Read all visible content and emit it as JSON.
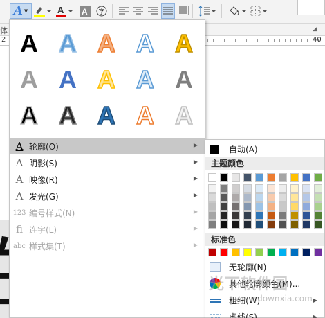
{
  "ribbon": {
    "text_effects_glyph": "A",
    "group_label": "体",
    "ruler_num_left": "2",
    "ruler_num_right": "40"
  },
  "document": {
    "chars": [
      "的",
      "卜",
      "轮"
    ]
  },
  "gallery": {
    "letter": "A",
    "items": [
      {
        "name": "solid-black",
        "fill": "#000000",
        "stroke": "none"
      },
      {
        "name": "blue-gradient",
        "fill": "#5b9bd5",
        "stroke": "#9cc3e6"
      },
      {
        "name": "orange-light",
        "fill": "#f4b183",
        "stroke": "#ed7d31"
      },
      {
        "name": "blue-outline",
        "fill": "#ffffff",
        "stroke": "#5b9bd5"
      },
      {
        "name": "gold",
        "fill": "#ffc000",
        "stroke": "#bf9000"
      },
      {
        "name": "grey",
        "fill": "#9e9e9e",
        "stroke": "none"
      },
      {
        "name": "blue-reflection",
        "fill": "#4472c4",
        "stroke": "none"
      },
      {
        "name": "yellow-outline",
        "fill": "#ffe699",
        "stroke": "#ffc000"
      },
      {
        "name": "blue-pale",
        "fill": "#ddebf7",
        "stroke": "#5b9bd5"
      },
      {
        "name": "grey-dark",
        "fill": "#7f7f7f",
        "stroke": "none"
      },
      {
        "name": "black-glow",
        "fill": "#000000",
        "stroke": "#bbbbbb"
      },
      {
        "name": "black-dark",
        "fill": "#262626",
        "stroke": "#7f7f7f"
      },
      {
        "name": "blue-bevel",
        "fill": "#2e75b6",
        "stroke": "#1f4e79"
      },
      {
        "name": "orange-outline",
        "fill": "#ffffff",
        "stroke": "#ed7d31"
      },
      {
        "name": "white-shadow",
        "fill": "#f2f2f2",
        "stroke": "#bfbfbf"
      }
    ]
  },
  "menu": {
    "items": [
      {
        "label": "轮廓(O)",
        "icon": "A",
        "highlighted": true,
        "disabled": false
      },
      {
        "label": "阴影(S)",
        "icon": "A",
        "highlighted": false,
        "disabled": false
      },
      {
        "label": "映像(R)",
        "icon": "A",
        "highlighted": false,
        "disabled": false
      },
      {
        "label": "发光(G)",
        "icon": "A",
        "highlighted": false,
        "disabled": false
      },
      {
        "label": "编号样式(N)",
        "icon": "123",
        "highlighted": false,
        "disabled": true
      },
      {
        "label": "连字(L)",
        "icon": "fi",
        "highlighted": false,
        "disabled": true
      },
      {
        "label": "样式集(T)",
        "icon": "abc",
        "highlighted": false,
        "disabled": true
      }
    ]
  },
  "outline_submenu": {
    "auto_label": "自动(A)",
    "theme_colors_title": "主题颜色",
    "theme_top_row": [
      "#ffffff",
      "#000000",
      "#e7e6e6",
      "#44546a",
      "#5b9bd5",
      "#ed7d31",
      "#a5a5a5",
      "#ffc000",
      "#4472c4",
      "#70ad47"
    ],
    "theme_shades": [
      [
        "#f2f2f2",
        "#7f7f7f",
        "#d0cece",
        "#d6dce4",
        "#ddebf7",
        "#fbe5d6",
        "#ededed",
        "#fff2cc",
        "#dae3f3",
        "#e2efda"
      ],
      [
        "#d9d9d9",
        "#595959",
        "#aeaaaa",
        "#adb9ca",
        "#bdd7ee",
        "#f8cbad",
        "#dbdbdb",
        "#ffe699",
        "#b4c7e7",
        "#c5e0b4"
      ],
      [
        "#bfbfbf",
        "#404040",
        "#757171",
        "#8497b0",
        "#9dc3e6",
        "#f4b183",
        "#c9c9c9",
        "#ffd966",
        "#8faadc",
        "#a9d18e"
      ],
      [
        "#a6a6a6",
        "#262626",
        "#3a3838",
        "#333f4f",
        "#2e75b6",
        "#c55a11",
        "#7b7b7b",
        "#bf9000",
        "#2f5597",
        "#548235"
      ],
      [
        "#7f7f7f",
        "#0d0d0d",
        "#171616",
        "#222a35",
        "#1f4e79",
        "#843c0c",
        "#525252",
        "#7f6000",
        "#203864",
        "#375623"
      ]
    ],
    "standard_colors_title": "标准色",
    "standard_colors": [
      "#c00000",
      "#ff0000",
      "#ffc000",
      "#ffff00",
      "#92d050",
      "#00b050",
      "#00b0f0",
      "#0070c0",
      "#002060",
      "#7030a0"
    ],
    "no_outline_label": "无轮廓(N)",
    "more_colors_label": "其他轮廓颜色(M)...",
    "weight_label": "粗细(W)",
    "dash_label": "虚线(S)"
  },
  "watermark": {
    "text": "光下软件园",
    "url": "www.downxia.com"
  }
}
